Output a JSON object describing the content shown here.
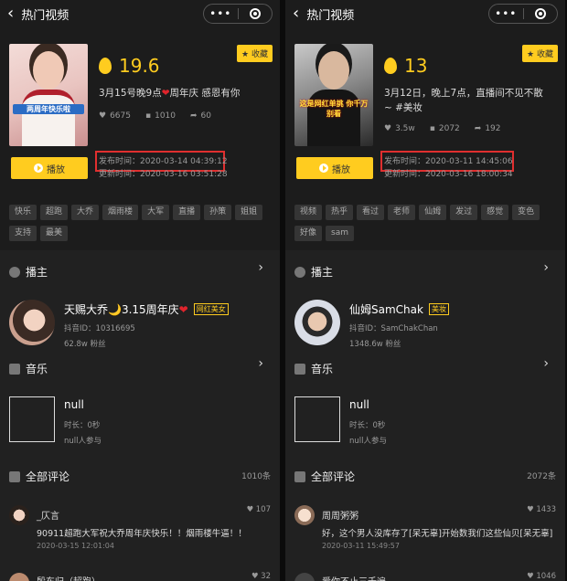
{
  "panels": [
    {
      "nav_title": "热门视频",
      "capsule_dots": "•••",
      "video_caption": "两周年快乐啦",
      "fav_label": "收藏",
      "score": "19.6",
      "title": "3月15号晚9点",
      "title_suffix": "周年庆 感恩有你",
      "likes": "6675",
      "comments": "1010",
      "shares": "60",
      "play_label": "播放",
      "publish_time": "发布时间：2020-03-14 04:39:12",
      "update_time": "更新时间：2020-03-16 03:51:28",
      "tags": [
        "快乐",
        "超跑",
        "大乔",
        "烟雨楼",
        "大军",
        "直播",
        "孙策",
        "姐姐",
        "支持",
        "最美"
      ],
      "anchor_label": "播主",
      "anchor_name": "天赐大乔🌙3.15周年庆",
      "anchor_badge": "网红美女",
      "anchor_id": "抖音ID：10316695",
      "anchor_fans": "62.8w 粉丝",
      "music_label": "音乐",
      "music_name": "null",
      "music_duration": "时长：0秒",
      "music_users": "null人参与",
      "comments_label": "全部评论",
      "comments_count": "1010条",
      "comment_list": [
        {
          "user": "_仄言",
          "likes": "107",
          "text": "90911超跑大军祝大乔周年庆快乐！！烟雨楼牛逼！！",
          "date": "2020-03-15 12:01:04"
        },
        {
          "user": "殷东归（超跑）",
          "likes": "32",
          "text": "",
          "date": ""
        }
      ]
    },
    {
      "nav_title": "热门视频",
      "capsule_dots": "•••",
      "video_caption": "这是网红单挑 你千万别看",
      "fav_label": "收藏",
      "score": "13",
      "title": "3月12日，晚上7点，直播间不见不散~ #美妆",
      "title_suffix": "",
      "likes": "3.5w",
      "comments": "2072",
      "shares": "192",
      "play_label": "播放",
      "publish_time": "发布时间：2020-03-11 14:45:06",
      "update_time": "更新时间：2020-03-16 18:00:34",
      "tags": [
        "视频",
        "热乎",
        "看过",
        "老师",
        "仙姆",
        "发过",
        "感觉",
        "变色",
        "好像",
        "sam"
      ],
      "anchor_label": "播主",
      "anchor_name": "仙姆SamChak",
      "anchor_badge": "美妆",
      "anchor_id": "抖音ID：SamChakChan",
      "anchor_fans": "1348.6w 粉丝",
      "music_label": "音乐",
      "music_name": "null",
      "music_duration": "时长：0秒",
      "music_users": "null人参与",
      "comments_label": "全部评论",
      "comments_count": "2072条",
      "comment_list": [
        {
          "user": "周周粥粥",
          "likes": "1433",
          "text": "好，这个男人没库存了[呆无辜]开始数我们这些仙贝[呆无辜]",
          "date": "2020-03-11 15:49:57"
        },
        {
          "user": "爱你不止三千遍",
          "likes": "1046",
          "text": "",
          "date": ""
        }
      ]
    }
  ],
  "colors": {
    "accent": "#ffcc1f",
    "highlight_box": "#e02f2f",
    "background": "#1c1c1c"
  }
}
